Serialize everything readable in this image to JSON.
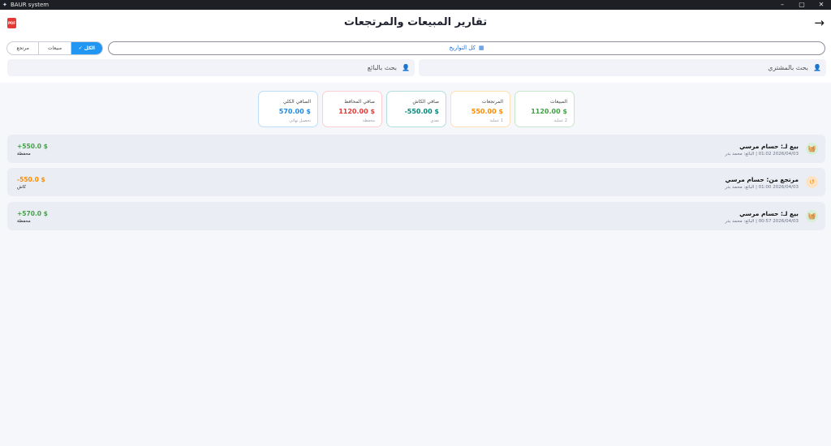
{
  "window": {
    "title": "BAUR system",
    "minimize": "–",
    "maximize": "▢",
    "close": "✕"
  },
  "header": {
    "title": "تقارير المبيعات والمرتجعات",
    "back_icon": "→",
    "pdf_label": "PDF"
  },
  "filters": {
    "segments": [
      {
        "label": "الكل",
        "check": "✓",
        "active": true
      },
      {
        "label": "مبيعات",
        "active": false
      },
      {
        "label": "مرتجع",
        "active": false
      }
    ],
    "date_label": "كل التواريخ",
    "customer_search_placeholder": "بحث بالمشتري",
    "seller_search_placeholder": "بحث بالبائع"
  },
  "stats": [
    {
      "label": "المبيعات",
      "value": "1120.00 $",
      "sub": "2 عملية",
      "color": "#43a047",
      "border": "#c8e6c9"
    },
    {
      "label": "المرتجعات",
      "value": "550.00 $",
      "sub": "1 عملية",
      "color": "#fb8c00",
      "border": "#ffe0b2"
    },
    {
      "label": "صافي الكاش",
      "value": "-550.00 $",
      "sub": "نقدي",
      "color": "#00897b",
      "border": "#b2dfdb"
    },
    {
      "label": "صافي المحافظ",
      "value": "1120.00 $",
      "sub": "محفظة",
      "color": "#e53935",
      "border": "#ffcdd2"
    },
    {
      "label": "الصافي الكلي",
      "value": "570.00 $",
      "sub": "تحصيل نهائي",
      "color": "#1e88e5",
      "border": "#bbdefb"
    }
  ],
  "transactions": [
    {
      "title": "بيع لـ: حسام مرسي",
      "meta": "2026/04/03 01:02 | البائع: محمد بدر",
      "amount": "+550.0 $",
      "method": "محفظة",
      "color": "#43a047",
      "icon_bg": "#d6efd8",
      "icon": "🧺"
    },
    {
      "title": "مرتجع من: حسام مرسي",
      "meta": "2026/04/03 01:00 | البائع: محمد بدر",
      "amount": "-550.0 $",
      "method": "كاش",
      "color": "#fb8c00",
      "icon_bg": "#fde3c4",
      "icon": "↺"
    },
    {
      "title": "بيع لـ: حسام مرسي",
      "meta": "2026/04/03 00:57 | البائع: محمد بدر",
      "amount": "+570.0 $",
      "method": "محفظة",
      "color": "#43a047",
      "icon_bg": "#d6efd8",
      "icon": "🧺"
    }
  ]
}
